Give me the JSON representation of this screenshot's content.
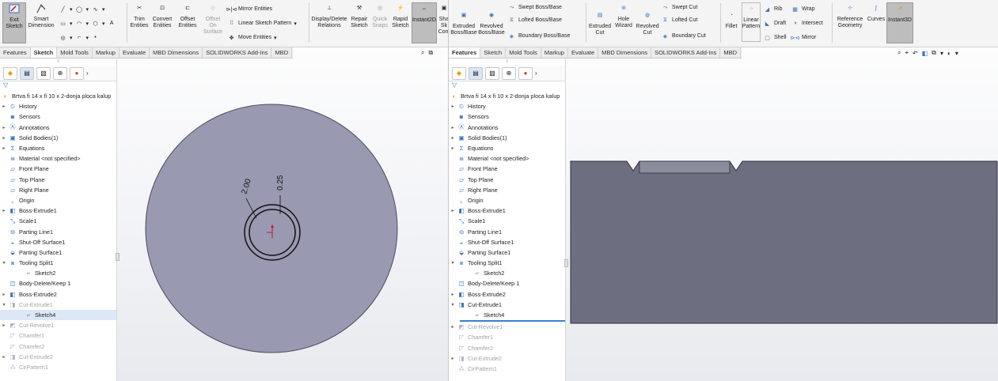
{
  "left": {
    "ribbon": {
      "exit_sketch": "Exit Sketch",
      "smart_dimension": "Smart Dimension",
      "trim_entities": "Trim Entities",
      "convert_entities": "Convert Entities",
      "offset_entities": "Offset Entities",
      "offset_on_surface": "Offset On Surface",
      "mirror_entities": "Mirror Entities",
      "linear_sketch_pattern": "Linear Sketch Pattern",
      "move_entities": "Move Entities",
      "display_delete_relations": "Display/Delete Relations",
      "repair_sketch": "Repair Sketch",
      "quick_snaps": "Quick Snaps",
      "rapid_sketch": "Rapid Sketch",
      "instant2d": "Instant2D",
      "sha_partial": "Sha Sk Com"
    },
    "tabs": [
      "Features",
      "Sketch",
      "Mold Tools",
      "Markup",
      "Evaluate",
      "MBD Dimensions",
      "SOLIDWORKS Add-Ins",
      "MBD"
    ],
    "active_tab": "Sketch",
    "part_name": "Brtva fi 14 x fi 10 x 2-donja ploca kalup",
    "tree": [
      {
        "label": "History",
        "exp": "▸",
        "icon": "history-icon"
      },
      {
        "label": "Sensors",
        "exp": "",
        "icon": "sensors-icon"
      },
      {
        "label": "Annotations",
        "exp": "▸",
        "icon": "annotations-icon"
      },
      {
        "label": "Solid Bodies(1)",
        "exp": "▸",
        "icon": "solid-bodies-icon"
      },
      {
        "label": "Equations",
        "exp": "▸",
        "icon": "equations-icon"
      },
      {
        "label": "Material <not specified>",
        "exp": "",
        "icon": "material-icon"
      },
      {
        "label": "Front Plane",
        "exp": "",
        "icon": "plane-icon"
      },
      {
        "label": "Top Plane",
        "exp": "",
        "icon": "plane-icon"
      },
      {
        "label": "Right Plane",
        "exp": "",
        "icon": "plane-icon"
      },
      {
        "label": "Origin",
        "exp": "",
        "icon": "origin-icon"
      },
      {
        "label": "Boss-Extrude1",
        "exp": "▸",
        "icon": "extrude-icon"
      },
      {
        "label": "Scale1",
        "exp": "",
        "icon": "scale-icon"
      },
      {
        "label": "Parting Line1",
        "exp": "",
        "icon": "parting-line-icon"
      },
      {
        "label": "Shut-Off Surface1",
        "exp": "",
        "icon": "shutoff-surface-icon"
      },
      {
        "label": "Parting Surface1",
        "exp": "",
        "icon": "parting-surface-icon"
      },
      {
        "label": "Tooling Split1",
        "exp": "▾",
        "icon": "tooling-split-icon"
      },
      {
        "label": "Sketch2",
        "exp": "",
        "icon": "sketch-icon",
        "indent": true
      },
      {
        "label": "Body-Delete/Keep 1",
        "exp": "",
        "icon": "body-delete-icon"
      },
      {
        "label": "Boss-Extrude2",
        "exp": "▸",
        "icon": "extrude-icon"
      },
      {
        "label": "Cut-Extrude1",
        "exp": "▾",
        "icon": "cut-extrude-icon",
        "grey": true
      },
      {
        "label": "Sketch4",
        "exp": "",
        "icon": "sketch-icon",
        "indent": true,
        "hl": true
      },
      {
        "label": "Cut-Revolve1",
        "exp": "▸",
        "icon": "cut-revolve-icon",
        "grey": true
      },
      {
        "label": "Chamfer1",
        "exp": "",
        "icon": "chamfer-icon",
        "grey": true
      },
      {
        "label": "Chamfer2",
        "exp": "",
        "icon": "chamfer-icon",
        "grey": true
      },
      {
        "label": "Cut-Extrude2",
        "exp": "▸",
        "icon": "cut-extrude-icon",
        "grey": true
      },
      {
        "label": "CirPattern1",
        "exp": "",
        "icon": "cirpattern-icon",
        "grey": true
      }
    ],
    "dims": {
      "d1": "2.00",
      "d2": "0.25"
    }
  },
  "right": {
    "ribbon": {
      "extruded_boss": "Extruded Boss/Base",
      "revolved_boss": "Revolved Boss/Base",
      "swept_boss": "Swept Boss/Base",
      "lofted_boss": "Lofted Boss/Base",
      "boundary_boss": "Boundary Boss/Base",
      "extruded_cut": "Extruded Cut",
      "hole_wizard": "Hole Wizard",
      "revolved_cut": "Revolved Cut",
      "swept_cut": "Swept Cut",
      "lofted_cut": "Lofted Cut",
      "boundary_cut": "Boundary Cut",
      "fillet": "Fillet",
      "linear_pattern": "Linear Pattern",
      "rib": "Rib",
      "draft": "Draft",
      "shell": "Shell",
      "wrap": "Wrap",
      "intersect": "Intersect",
      "mirror": "Mirror",
      "reference_geometry": "Reference Geometry",
      "curves": "Curves",
      "instant3d": "Instant3D"
    },
    "tabs": [
      "Features",
      "Sketch",
      "Mold Tools",
      "Markup",
      "Evaluate",
      "MBD Dimensions",
      "SOLIDWORKS Add-Ins",
      "MBD"
    ],
    "active_tab": "Features",
    "part_name": "Brtva fi 14 x fi 10 x 2-donja ploca kalup",
    "tree": [
      {
        "label": "History",
        "exp": "▸",
        "icon": "history-icon"
      },
      {
        "label": "Sensors",
        "exp": "",
        "icon": "sensors-icon"
      },
      {
        "label": "Annotations",
        "exp": "▸",
        "icon": "annotations-icon"
      },
      {
        "label": "Solid Bodies(1)",
        "exp": "▸",
        "icon": "solid-bodies-icon"
      },
      {
        "label": "Equations",
        "exp": "▸",
        "icon": "equations-icon"
      },
      {
        "label": "Material <not specified>",
        "exp": "",
        "icon": "material-icon"
      },
      {
        "label": "Front Plane",
        "exp": "",
        "icon": "plane-icon"
      },
      {
        "label": "Top Plane",
        "exp": "",
        "icon": "plane-icon"
      },
      {
        "label": "Right Plane",
        "exp": "",
        "icon": "plane-icon"
      },
      {
        "label": "Origin",
        "exp": "",
        "icon": "origin-icon"
      },
      {
        "label": "Boss-Extrude1",
        "exp": "▸",
        "icon": "extrude-icon"
      },
      {
        "label": "Scale1",
        "exp": "",
        "icon": "scale-icon"
      },
      {
        "label": "Parting Line1",
        "exp": "",
        "icon": "parting-line-icon"
      },
      {
        "label": "Shut-Off Surface1",
        "exp": "",
        "icon": "shutoff-surface-icon"
      },
      {
        "label": "Parting Surface1",
        "exp": "",
        "icon": "parting-surface-icon"
      },
      {
        "label": "Tooling Split1",
        "exp": "▾",
        "icon": "tooling-split-icon"
      },
      {
        "label": "Sketch2",
        "exp": "",
        "icon": "sketch-icon",
        "indent": true
      },
      {
        "label": "Body-Delete/Keep 1",
        "exp": "",
        "icon": "body-delete-icon"
      },
      {
        "label": "Boss-Extrude2",
        "exp": "▸",
        "icon": "extrude-icon"
      },
      {
        "label": "Cut-Extrude1",
        "exp": "▾",
        "icon": "cut-extrude-icon"
      },
      {
        "label": "Sketch4",
        "exp": "",
        "icon": "sketch-icon",
        "indent": true
      },
      {
        "rollback": true
      },
      {
        "label": "Cut-Revolve1",
        "exp": "▸",
        "icon": "cut-revolve-icon",
        "grey": true
      },
      {
        "label": "Chamfer1",
        "exp": "",
        "icon": "chamfer-icon",
        "grey": true
      },
      {
        "label": "Chamfer2",
        "exp": "",
        "icon": "chamfer-icon",
        "grey": true
      },
      {
        "label": "Cut-Extrude2",
        "exp": "▸",
        "icon": "cut-extrude-icon",
        "grey": true
      },
      {
        "label": "CirPattern1",
        "exp": "",
        "icon": "cirpattern-icon",
        "grey": true
      }
    ]
  },
  "colors": {
    "body": "#9a9cb2",
    "body_side": "#6d6f80",
    "ribbon_active": "#bdbdbd",
    "tree_highlight": "#dde8f6",
    "rollback_bar": "#3a7fd0",
    "sw_red": "#c8102e"
  }
}
